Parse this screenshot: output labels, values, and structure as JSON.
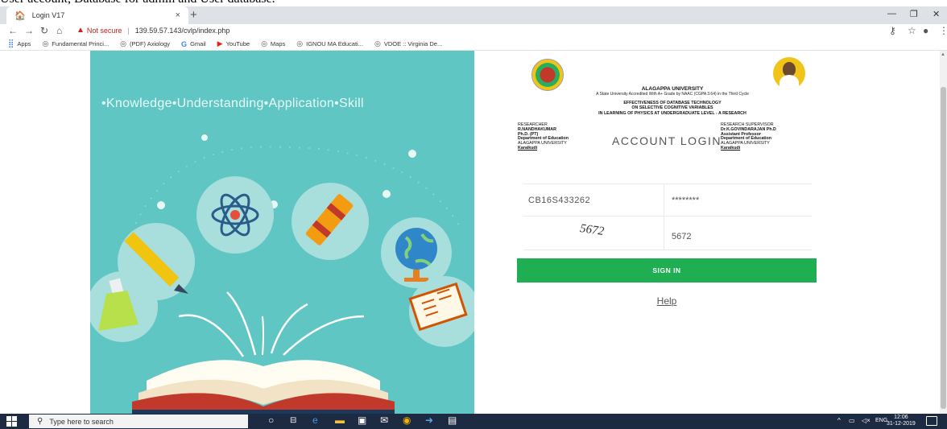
{
  "caption": "User account, Database for admin and User database.",
  "browser": {
    "tab_title": "Login V17",
    "tab_close": "×",
    "new_tab": "+",
    "not_secure": "Not secure",
    "url": "139.59.57.143/cvlp/index.php",
    "bookmarks": [
      {
        "label": "Apps",
        "icon": "apps-grid-icon"
      },
      {
        "label": "Fundamental Princi...",
        "icon": "globe-icon"
      },
      {
        "label": "(PDF) Axiology",
        "icon": "globe-icon"
      },
      {
        "label": "Gmail",
        "icon": "google-icon"
      },
      {
        "label": "YouTube",
        "icon": "youtube-icon"
      },
      {
        "label": "Maps",
        "icon": "globe-icon"
      },
      {
        "label": "IGNOU MA Educati...",
        "icon": "globe-icon"
      },
      {
        "label": "VDOE :: Virginia De...",
        "icon": "globe-icon"
      }
    ]
  },
  "hero": {
    "tagline": "•Knowledge•Understanding•Application•Skill"
  },
  "login": {
    "university": "ALAGAPPA UNIVERSITY",
    "accreditation": "A State University Accredited With A+ Grade by NAAC (CGPA 3.64) in the Third Cycle",
    "project_line1": "EFFECTIVENESS OF DATABASE TECHNOLOGY",
    "project_line2": "ON SELECTIVE COGNITIVE VARIABLES",
    "project_line3": "IN LEARNING OF PHYSICS AT UNDERGRADUATE LEVEL - A RESEARCH",
    "researcher": {
      "heading": "RESEARCHER",
      "name": "R.NANDHAKUMAR",
      "degree": "Ph.D. (PT)",
      "dept": "Department of Education",
      "uni": "ALAGAPPA UNIVERSITY",
      "place": "Karaikudi"
    },
    "supervisor": {
      "heading": "RESEARCH SUPERVISOR",
      "name": "Dr.K.GOVINDARAJAN Ph.D",
      "role": "Assistant Professor",
      "dept": "Department of Education",
      "uni": "ALAGAPPA UNIVERSITY",
      "place": "Karaikudi"
    },
    "title": "ACCOUNT LOGIN",
    "username_value": "CB16S433262",
    "password_value": "********",
    "captcha_text": "5672",
    "captcha_value": "5672",
    "signin_label": "SIGN IN",
    "help_label": "Help"
  },
  "taskbar": {
    "search_placeholder": "Type here to search",
    "language": "ENG",
    "time": "12:06",
    "date": "31-12-2019"
  },
  "colors": {
    "panel_teal": "#5fc6c3",
    "signin_green": "#1fae52",
    "taskbar": "#1c2a42",
    "not_secure_red": "#c5221f"
  }
}
